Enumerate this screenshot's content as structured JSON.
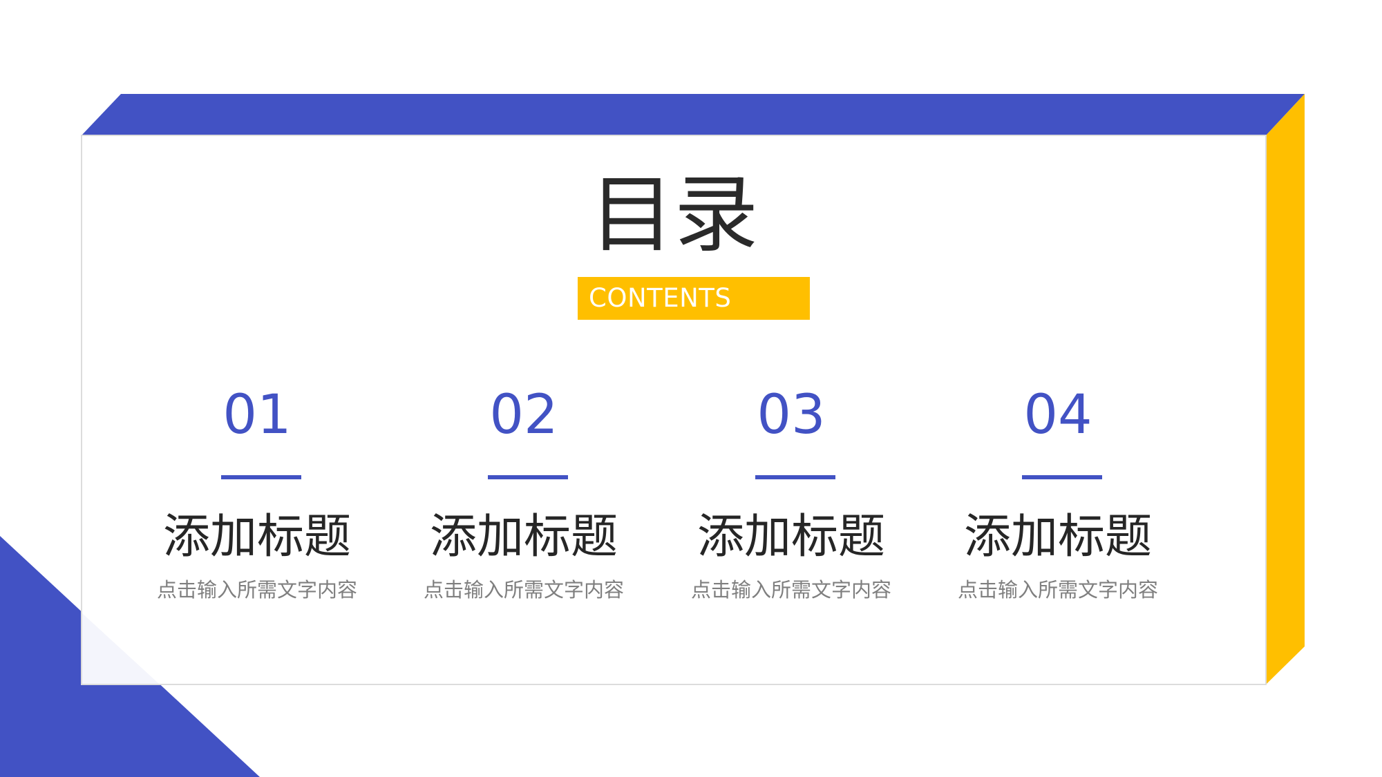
{
  "slide": {
    "title": "目录",
    "subtitle": "CONTENTS"
  },
  "items": [
    {
      "number": "01",
      "heading": "添加标题",
      "description": "点击输入所需文字内容"
    },
    {
      "number": "02",
      "heading": "添加标题",
      "description": "点击输入所需文字内容"
    },
    {
      "number": "03",
      "heading": "添加标题",
      "description": "点击输入所需文字内容"
    },
    {
      "number": "04",
      "heading": "添加标题",
      "description": "点击输入所需文字内容"
    }
  ],
  "colors": {
    "primary_blue": "#4252c4",
    "accent_yellow": "#ffbf00",
    "title_text": "#2a2a2a",
    "desc_text": "#7f7f7f"
  }
}
